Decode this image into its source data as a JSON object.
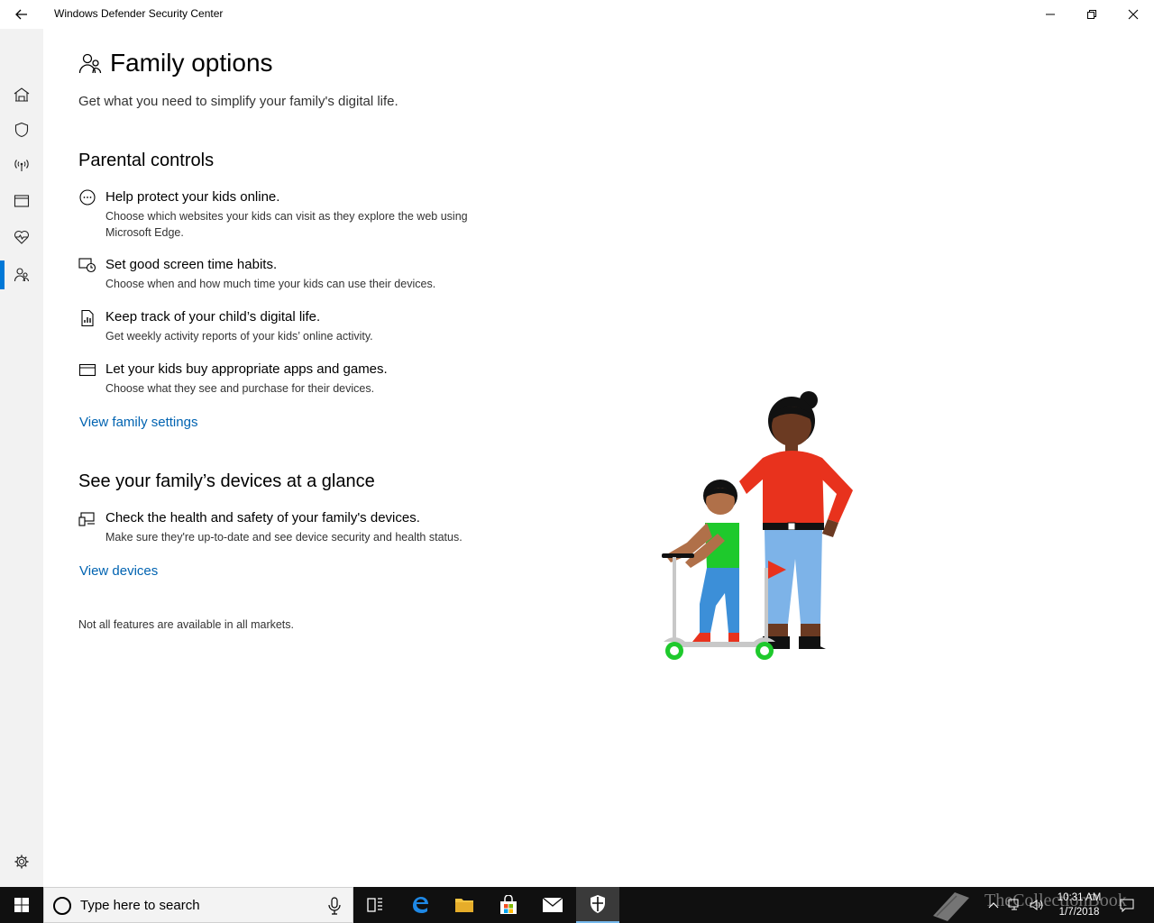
{
  "window": {
    "title": "Windows Defender Security Center"
  },
  "nav": {
    "items": [
      {
        "name": "home-icon"
      },
      {
        "name": "shield-icon"
      },
      {
        "name": "network-antenna-icon"
      },
      {
        "name": "app-browser-icon"
      },
      {
        "name": "heart-pulse-icon"
      },
      {
        "name": "family-icon",
        "active": true
      }
    ],
    "settings": {
      "name": "settings-gear-icon"
    }
  },
  "page": {
    "title": "Family options",
    "subtitle": "Get what you need to simplify your family's digital life."
  },
  "parental_controls": {
    "heading": "Parental controls",
    "features": [
      {
        "icon": "chat-bubble-icon",
        "title": "Help protect your kids online.",
        "desc": "Choose which websites your kids can visit as they explore the web using Microsoft Edge."
      },
      {
        "icon": "screen-clock-icon",
        "title": "Set good screen time habits.",
        "desc": "Choose when and how much time your kids can use their devices."
      },
      {
        "icon": "report-document-icon",
        "title": "Keep track of your child’s digital life.",
        "desc": "Get weekly activity reports of your kids’ online activity."
      },
      {
        "icon": "credit-card-icon",
        "title": "Let your kids buy appropriate apps and games.",
        "desc": "Choose what they see and purchase for their devices."
      }
    ],
    "link": "View family settings"
  },
  "devices": {
    "heading": "See your family’s devices at a glance",
    "feature": {
      "icon": "devices-icon",
      "title": "Check the health and safety of your family's devices.",
      "desc": "Make sure they're up-to-date and see device security and health status."
    },
    "link": "View devices"
  },
  "footnote": "Not all features are available in all markets.",
  "taskbar": {
    "search_placeholder": "Type here to search",
    "time": "10:31 AM",
    "date": "1/7/2018",
    "watermark": "TheCollectionBook"
  },
  "colors": {
    "accent": "#0078d7",
    "link": "#0063b1",
    "nav_bg": "#f2f2f2",
    "taskbar_bg": "#101010"
  }
}
